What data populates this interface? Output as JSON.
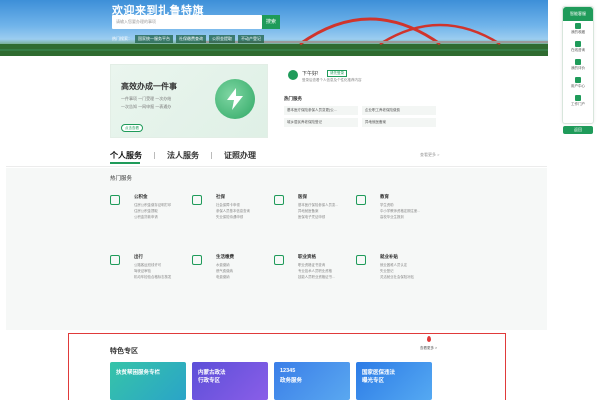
{
  "banner": {
    "title": "欢迎来到扎鲁特旗",
    "search_placeholder": "请输入您要办理的事项",
    "search_button": "搜索",
    "hot_label": "热门搜索：",
    "hot_tags": [
      "国家统一服务平台",
      "社保缴费查询",
      "公积金提取",
      "不动产登记"
    ]
  },
  "sidebar": {
    "head": "智能客服",
    "items": [
      "我的收藏",
      "在线咨询",
      "我的评价",
      "用户中心",
      "工作门户"
    ],
    "bottom": "返回"
  },
  "hero": {
    "title": "高效办成一件事",
    "line1": "一件事项 一门受理 一次办结",
    "line2": "一次告知 一网申报 一表通办",
    "button": "点击查看"
  },
  "user_panel": {
    "greeting": "下午好!",
    "login": "请先登录",
    "tip": "登录后查看个人信息及个性化推荐内容",
    "hot_title": "热门服务",
    "links": [
      "基本医疗保险参保人员变更(公...",
      "企业职工养老保险缴费",
      "城乡居民养老保险登记",
      "异地就医备案"
    ]
  },
  "tabs": {
    "items": [
      "个人服务",
      "法人服务",
      "证照办理"
    ],
    "more": "查看更多 >"
  },
  "services": {
    "heading": "热门服务",
    "items": [
      {
        "title": "公积金",
        "icon": "house-icon",
        "lines": [
          "住房公积金缴存证明打印",
          "住房公积金提取",
          "公积金贷款申请"
        ]
      },
      {
        "title": "社保",
        "icon": "social-security-icon",
        "lines": [
          "社会保障卡申领",
          "参保人员基本信息查询",
          "失业保险待遇申领"
        ]
      },
      {
        "title": "医保",
        "icon": "medical-insurance-icon",
        "lines": [
          "基本医疗保险参保人员变...",
          "异地就医备案",
          "医保电子凭证申领"
        ]
      },
      {
        "title": "教育",
        "icon": "education-icon",
        "lines": [
          "学生资助",
          "中小学教师资格定期注册...",
          "高校毕业生报到"
        ]
      },
      {
        "title": "出行",
        "icon": "travel-icon",
        "lines": [
          "公路客运班线许可",
          "驾驶证审验",
          "机动车检验合格标志核发"
        ]
      },
      {
        "title": "生活缴费",
        "icon": "life-payment-icon",
        "lines": [
          "水费缴纳",
          "燃气费缴纳",
          "电费缴纳"
        ]
      },
      {
        "title": "职业资格",
        "icon": "qualification-icon",
        "lines": [
          "职业资格证书查询",
          "专业技术人员职业资格",
          "技能人员职业资格证书..."
        ]
      },
      {
        "title": "就业补贴",
        "icon": "employment-icon",
        "lines": [
          "就业困难人员认定",
          "失业登记",
          "灵活就业社会保险补贴"
        ]
      }
    ]
  },
  "featured": {
    "title": "特色专区",
    "more": "查看更多 >",
    "cards": [
      {
        "line1": "扶贫帮困服务专栏",
        "line2": ""
      },
      {
        "line1": "内蒙古政法",
        "line2": "行政专区"
      },
      {
        "line1": "12345",
        "line2": "政务服务"
      },
      {
        "line1": "国家医保违法",
        "line2": "曝光专区"
      }
    ]
  },
  "colors": {
    "primary": "#1f9b5a",
    "highlight_border": "#e03a3a"
  }
}
